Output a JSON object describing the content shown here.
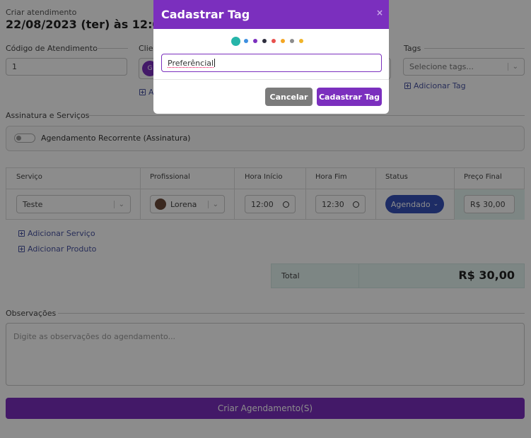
{
  "page": {
    "subtitle": "Criar atendimento",
    "datetime": "22/08/2023 (ter) às 12:00"
  },
  "codigo": {
    "label": "Código de Atendimento",
    "value": "1"
  },
  "cliente": {
    "label": "Clie",
    "avatar_text": "G",
    "add_link": "A"
  },
  "tags": {
    "label": "Tags",
    "placeholder": "Selecione tags...",
    "add_link": "Adicionar Tag"
  },
  "assinatura": {
    "label": "Assinatura e Serviços",
    "toggle_label": "Agendamento Recorrente (Assinatura)"
  },
  "table": {
    "headers": [
      "Serviço",
      "Profissional",
      "Hora Início",
      "Hora Fim",
      "Status",
      "Preço Final"
    ],
    "row": {
      "servico": "Teste",
      "profissional": "Lorena",
      "hora_inicio": "12:00",
      "hora_fim": "12:30",
      "status": "Agendado",
      "preco": "R$ 30,00"
    }
  },
  "links": {
    "add_servico": "Adicionar Serviço",
    "add_produto": "Adicionar Produto"
  },
  "total": {
    "label": "Total",
    "value": "R$ 30,00"
  },
  "obs": {
    "label": "Observações",
    "placeholder": "Digite as observações do agendamento..."
  },
  "submit": {
    "label": "Criar Agendamento(S)"
  },
  "modal": {
    "title": "Cadastrar Tag",
    "close": "×",
    "input_value": "Preferêncial",
    "cancel": "Cancelar",
    "confirm": "Cadastrar Tag",
    "colors": [
      "#26b5a9",
      "#3d8fe0",
      "#7b2fbe",
      "#2d2d3d",
      "#e8504d",
      "#f4a623",
      "#8c8c8c",
      "#f0b429"
    ],
    "selected_color": "#26b5a9"
  },
  "accent": "#7b2fbe"
}
